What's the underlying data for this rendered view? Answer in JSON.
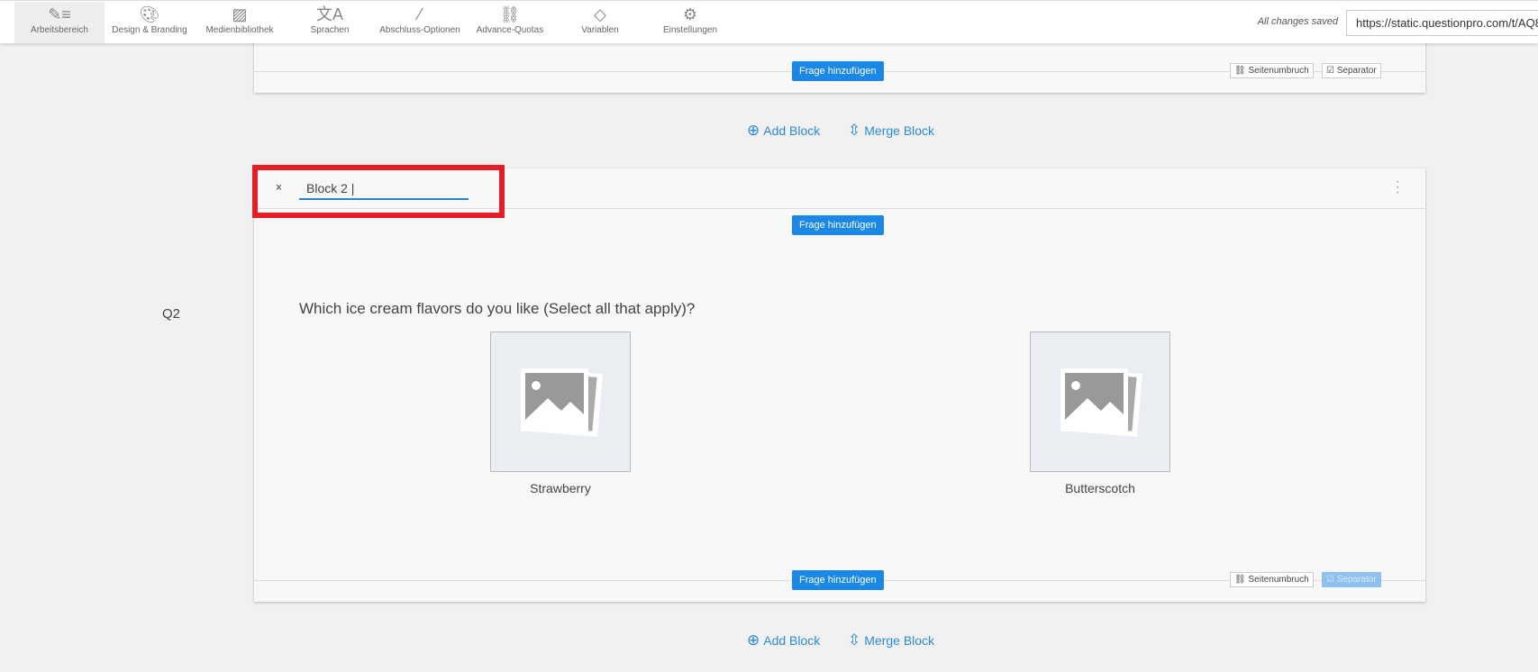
{
  "nav": {
    "items": [
      "Arbeitsbereich",
      "Design & Branding",
      "Medienbibliothek",
      "Sprachen",
      "Abschluss-Optionen",
      "Advance-Quotas",
      "Variablen",
      "Einstellungen"
    ],
    "status": "All changes saved",
    "url": "https://static.questionpro.com/t/AQ8"
  },
  "top_card": {
    "add_question": "Frage hinzufügen",
    "page_break": "Seitenumbruch",
    "separator": "Separator"
  },
  "block_actions": {
    "add_block": "Add Block",
    "merge_block": "Merge Block"
  },
  "block2": {
    "title": "Block 2",
    "add_question": "Frage hinzufügen",
    "question_number": "Q2",
    "question_text": "Which ice cream flavors do you like (Select all that apply)?",
    "options": [
      "Strawberry",
      "Butterscotch"
    ],
    "page_break": "Seitenumbruch",
    "separator": "Separator"
  },
  "colors": {
    "accent": "#1b87e6",
    "highlight": "#e41e26"
  }
}
